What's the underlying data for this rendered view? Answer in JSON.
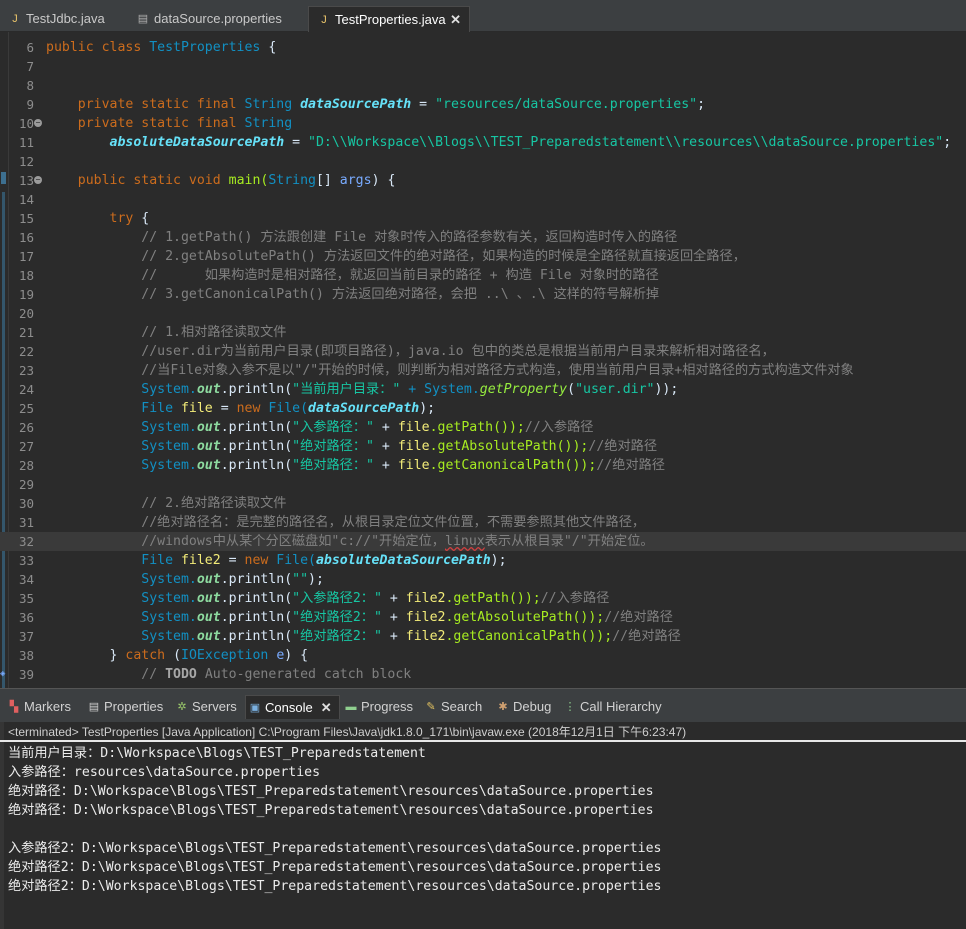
{
  "editor_tabs": [
    {
      "label": "TestJdbc.java",
      "icon": "java-file-icon"
    },
    {
      "label": "dataSource.properties",
      "icon": "properties-file-icon"
    },
    {
      "label": "TestProperties.java",
      "icon": "java-file-icon",
      "active": true,
      "close": "✕"
    }
  ],
  "code": {
    "ln": [
      "6",
      "7",
      "8",
      "9",
      "10",
      "11",
      "12",
      "13",
      "14",
      "15",
      "16",
      "17",
      "18",
      "19",
      "20",
      "21",
      "22",
      "23",
      "24",
      "25",
      "26",
      "27",
      "28",
      "29",
      "30",
      "31",
      "32",
      "33",
      "34",
      "35",
      "36",
      "37",
      "38",
      "39"
    ],
    "l6": {
      "a": "public class ",
      "b": "TestProperties",
      "c": " {"
    },
    "l9": {
      "a": "private static final ",
      "b": "String ",
      "c": "dataSourcePath",
      "d": " = ",
      "e": "\"resources/dataSource.properties\"",
      "f": ";"
    },
    "l10": {
      "a": "private static final ",
      "b": "String"
    },
    "l11": {
      "a": "absoluteDataSourcePath",
      "b": " = ",
      "c": "\"D:\\\\Workspace\\\\Blogs\\\\TEST_Preparedstatement\\\\resources\\\\dataSource.properties\"",
      "d": ";"
    },
    "l13": {
      "a": "public static void ",
      "b": "main(",
      "c": "String",
      "d": "[] ",
      "e": "args",
      "f": ") {"
    },
    "l15": {
      "a": "try",
      "b": " {"
    },
    "l16": "// 1.getPath() 方法跟创建 File 对象时传入的路径参数有关，返回构造时传入的路径",
    "l17": "// 2.getAbsolutePath() 方法返回文件的绝对路径，如果构造的时候是全路径就直接返回全路径，",
    "l18": "//      如果构造时是相对路径，就返回当前目录的路径 + 构造 File 对象时的路径",
    "l19": "// 3.getCanonicalPath() 方法返回绝对路径，会把 ..\\ 、.\\ 这样的符号解析掉",
    "l21": "// 1.相对路径读取文件",
    "l22": "//user.dir为当前用户目录(即项目路径)，java.io 包中的类总是根据当前用户目录来解析相对路径名，",
    "l23": "//当File对象入参不是以\"/\"开始的时候，则判断为相对路径方式构造，使用当前用户目录+相对路径的方式构造文件对象",
    "l24": {
      "a": "System.",
      "b": "out",
      ".c": "",
      "c": ".println(",
      "d": "\"当前用户目录：\"",
      "e": " + System.",
      "f": "getProperty",
      "g": "(",
      "h": "\"user.dir\"",
      "i": "));"
    },
    "l25": {
      "a": "File ",
      "b": "file",
      "c": " = ",
      "d": "new ",
      "e": "File(",
      "f": "dataSourcePath",
      "g": ");"
    },
    "l26": {
      "a": "System.",
      "b": "out",
      "c": ".println(",
      "d": "\"入参路径：\"",
      "e": " + ",
      "f": "file",
      ".g": "",
      "g": ".getPath());",
      "h": "//入参路径"
    },
    "l27": {
      "a": "System.",
      "b": "out",
      "c": ".println(",
      "d": "\"绝对路径：\"",
      "e": " + ",
      "f": "file",
      "g": ".getAbsolutePath());",
      "h": "//绝对路径"
    },
    "l28": {
      "a": "System.",
      "b": "out",
      "c": ".println(",
      "d": "\"绝对路径：\"",
      "e": " + ",
      "f": "file",
      "g": ".getCanonicalPath());",
      "h": "//绝对路径"
    },
    "l30": "// 2.绝对路径读取文件",
    "l31": "//绝对路径名：是完整的路径名，从根目录定位文件位置，不需要参照其他文件路径，",
    "l32": {
      "a": "//windows中从某个分区磁盘如\"c://\"开始定位，",
      "b": "linux",
      "c": "表示从根目录\"/\"开始定位。"
    },
    "l33": {
      "a": "File ",
      "b": "file2",
      "c": " = ",
      "d": "new ",
      "e": "File(",
      "f": "absoluteDataSourcePath",
      "g": ");"
    },
    "l34": {
      "a": "System.",
      "b": "out",
      "c": ".println(",
      "d": "\"\"",
      "e": ");"
    },
    "l35": {
      "a": "System.",
      "b": "out",
      "c": ".println(",
      "d": "\"入参路径2：\"",
      "e": " + ",
      "f": "file2",
      "g": ".getPath());",
      "h": "//入参路径"
    },
    "l36": {
      "a": "System.",
      "b": "out",
      "c": ".println(",
      "d": "\"绝对路径2：\"",
      "e": " + ",
      "f": "file2",
      "g": ".getAbsolutePath());",
      "h": "//绝对路径"
    },
    "l37": {
      "a": "System.",
      "b": "out",
      "c": ".println(",
      "d": "\"绝对路径2：\"",
      "e": " + ",
      "f": "file2",
      "g": ".getCanonicalPath());",
      "h": "//绝对路径"
    },
    "l38": {
      "a": "} ",
      "b": "catch",
      "c": " (",
      "d": "IOException",
      "e": " ",
      "f": "e",
      "g": ") {"
    },
    "l39": {
      "a": "// ",
      "b": "TODO",
      "c": " Auto-generated catch block"
    }
  },
  "views": [
    {
      "label": "Markers",
      "icon": "markers-icon"
    },
    {
      "label": "Properties",
      "icon": "properties-icon"
    },
    {
      "label": "Servers",
      "icon": "servers-icon"
    },
    {
      "label": "Console",
      "icon": "console-icon",
      "active": true,
      "close": "✕"
    },
    {
      "label": "Progress",
      "icon": "progress-icon"
    },
    {
      "label": "Search",
      "icon": "search-icon"
    },
    {
      "label": "Debug",
      "icon": "debug-icon"
    },
    {
      "label": "Call Hierarchy",
      "icon": "call-hierarchy-icon"
    }
  ],
  "console": {
    "status": "<terminated> TestProperties [Java Application] C:\\Program Files\\Java\\jdk1.8.0_171\\bin\\javaw.exe (2018年12月1日 下午6:23:47)",
    "lines": [
      "当前用户目录：D:\\Workspace\\Blogs\\TEST_Preparedstatement",
      "入参路径：resources\\dataSource.properties",
      "绝对路径：D:\\Workspace\\Blogs\\TEST_Preparedstatement\\resources\\dataSource.properties",
      "绝对路径：D:\\Workspace\\Blogs\\TEST_Preparedstatement\\resources\\dataSource.properties",
      "",
      "入参路径2：D:\\Workspace\\Blogs\\TEST_Preparedstatement\\resources\\dataSource.properties",
      "绝对路径2：D:\\Workspace\\Blogs\\TEST_Preparedstatement\\resources\\dataSource.properties",
      "绝对路径2：D:\\Workspace\\Blogs\\TEST_Preparedstatement\\resources\\dataSource.properties"
    ]
  }
}
